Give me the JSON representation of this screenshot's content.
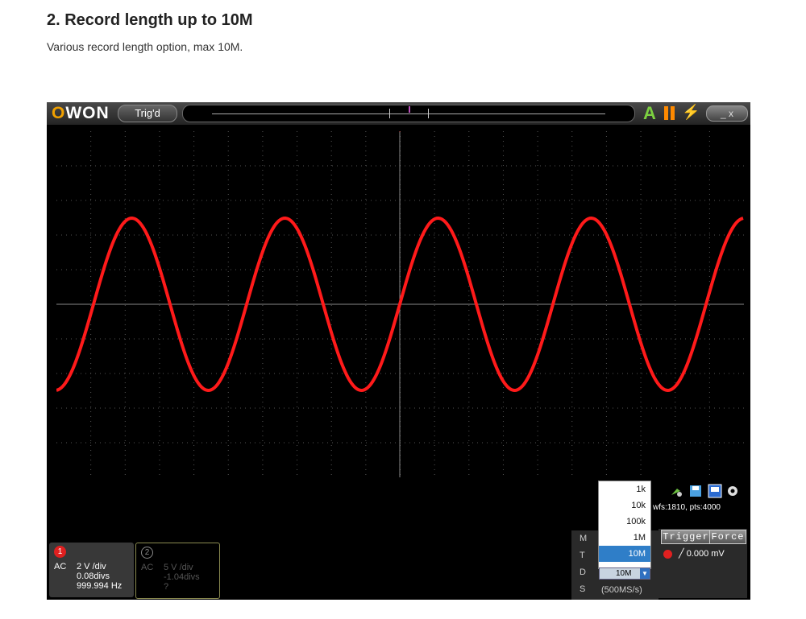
{
  "heading": "2. Record length up to 10M",
  "subheading": "Various record length option, max 10M.",
  "scope": {
    "logo": "OWON",
    "trigger_status": "Trig'd",
    "window_controls": "_ x",
    "ch1": {
      "num": "1",
      "coupling": "AC",
      "scale": "2 V /div",
      "offset": "0.08divs",
      "freq": "999.994 Hz"
    },
    "ch2": {
      "num": "2",
      "coupling": "AC",
      "scale": "5 V /div",
      "offset": "-1.04divs",
      "freq": "?"
    },
    "mtds_labels": {
      "m": "M",
      "t": "T",
      "d": "D",
      "s": "S"
    },
    "record_options": [
      "1k",
      "10k",
      "100k",
      "1M",
      "10M"
    ],
    "record_selected": "10M",
    "sample_rate": "(500MS/s)",
    "wfs_info": "wfs:1810, pts:4000",
    "trigger_label": "Trigger",
    "force_label": "Force",
    "trigger_level": "0.000 mV",
    "wave_color": "#ff1a1a"
  }
}
